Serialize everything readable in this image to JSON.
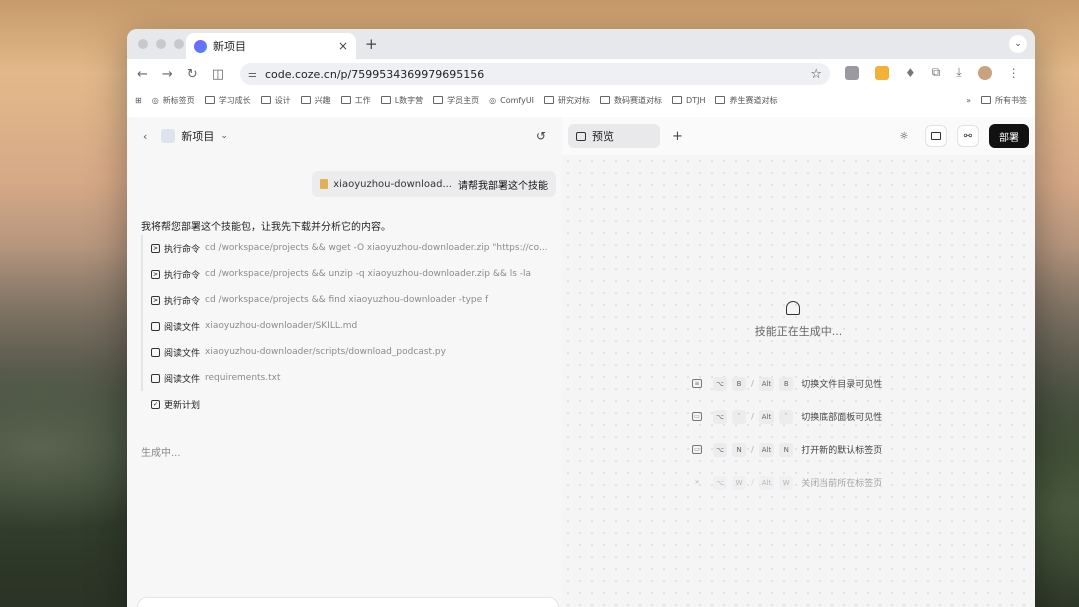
{
  "browser": {
    "tab_title": "新项目",
    "tab_close": "×",
    "new_tab": "+",
    "url": "code.coze.cn/p/7599534369979695156",
    "bookmarks": [
      "新标签页",
      "学习成长",
      "设计",
      "兴趣",
      "工作",
      "L数字营",
      "学员主页",
      "ComfyUI",
      "研究对标",
      "数码赛道对标",
      "DTJH",
      "养生赛道对标"
    ],
    "bookmarks_more": "»",
    "all_bookmarks": "所有书签"
  },
  "chat": {
    "project_name": "新项目",
    "user_message": {
      "file": "xiaoyuzhou-download...",
      "text": "请帮我部署这个技能"
    },
    "assistant_intro": "我将帮您部署这个技能包，让我先下载并分析它的内容。",
    "steps": [
      {
        "verb": "执行命令",
        "detail": "cd /workspace/projects && wget -O xiaoyuzhou-downloader.zip \"https://co..."
      },
      {
        "verb": "执行命令",
        "detail": "cd /workspace/projects && unzip -q xiaoyuzhou-downloader.zip && ls -la"
      },
      {
        "verb": "执行命令",
        "detail": "cd /workspace/projects && find xiaoyuzhou-downloader -type f"
      },
      {
        "verb": "阅读文件",
        "detail": "xiaoyuzhou-downloader/SKILL.md"
      },
      {
        "verb": "阅读文件",
        "detail": "xiaoyuzhou-downloader/scripts/download_podcast.py"
      },
      {
        "verb": "阅读文件",
        "detail": "requirements.txt"
      }
    ],
    "plan_label": "更新计划",
    "generating": "生成中..."
  },
  "preview": {
    "tab_label": "预览",
    "add_tab": "+",
    "deploy_label": "部署",
    "status": "技能正在生成中...",
    "shortcuts": [
      {
        "keys1": [
          "⌥",
          "B"
        ],
        "keys2": [
          "Alt",
          "B"
        ],
        "label": "切换文件目录可见性"
      },
      {
        "keys1": [
          "⌥",
          "`"
        ],
        "keys2": [
          "Alt",
          "`"
        ],
        "label": "切换底部面板可见性"
      },
      {
        "keys1": [
          "⌥",
          "N"
        ],
        "keys2": [
          "Alt",
          "N"
        ],
        "label": "打开新的默认标签页"
      },
      {
        "keys1": [
          "⌥",
          "W"
        ],
        "keys2": [
          "Alt",
          "W"
        ],
        "label": "关闭当前所在标签页"
      }
    ],
    "slash": "/"
  },
  "colors": {
    "deploy_bg": "#111111",
    "accent": "#7b5cff"
  }
}
